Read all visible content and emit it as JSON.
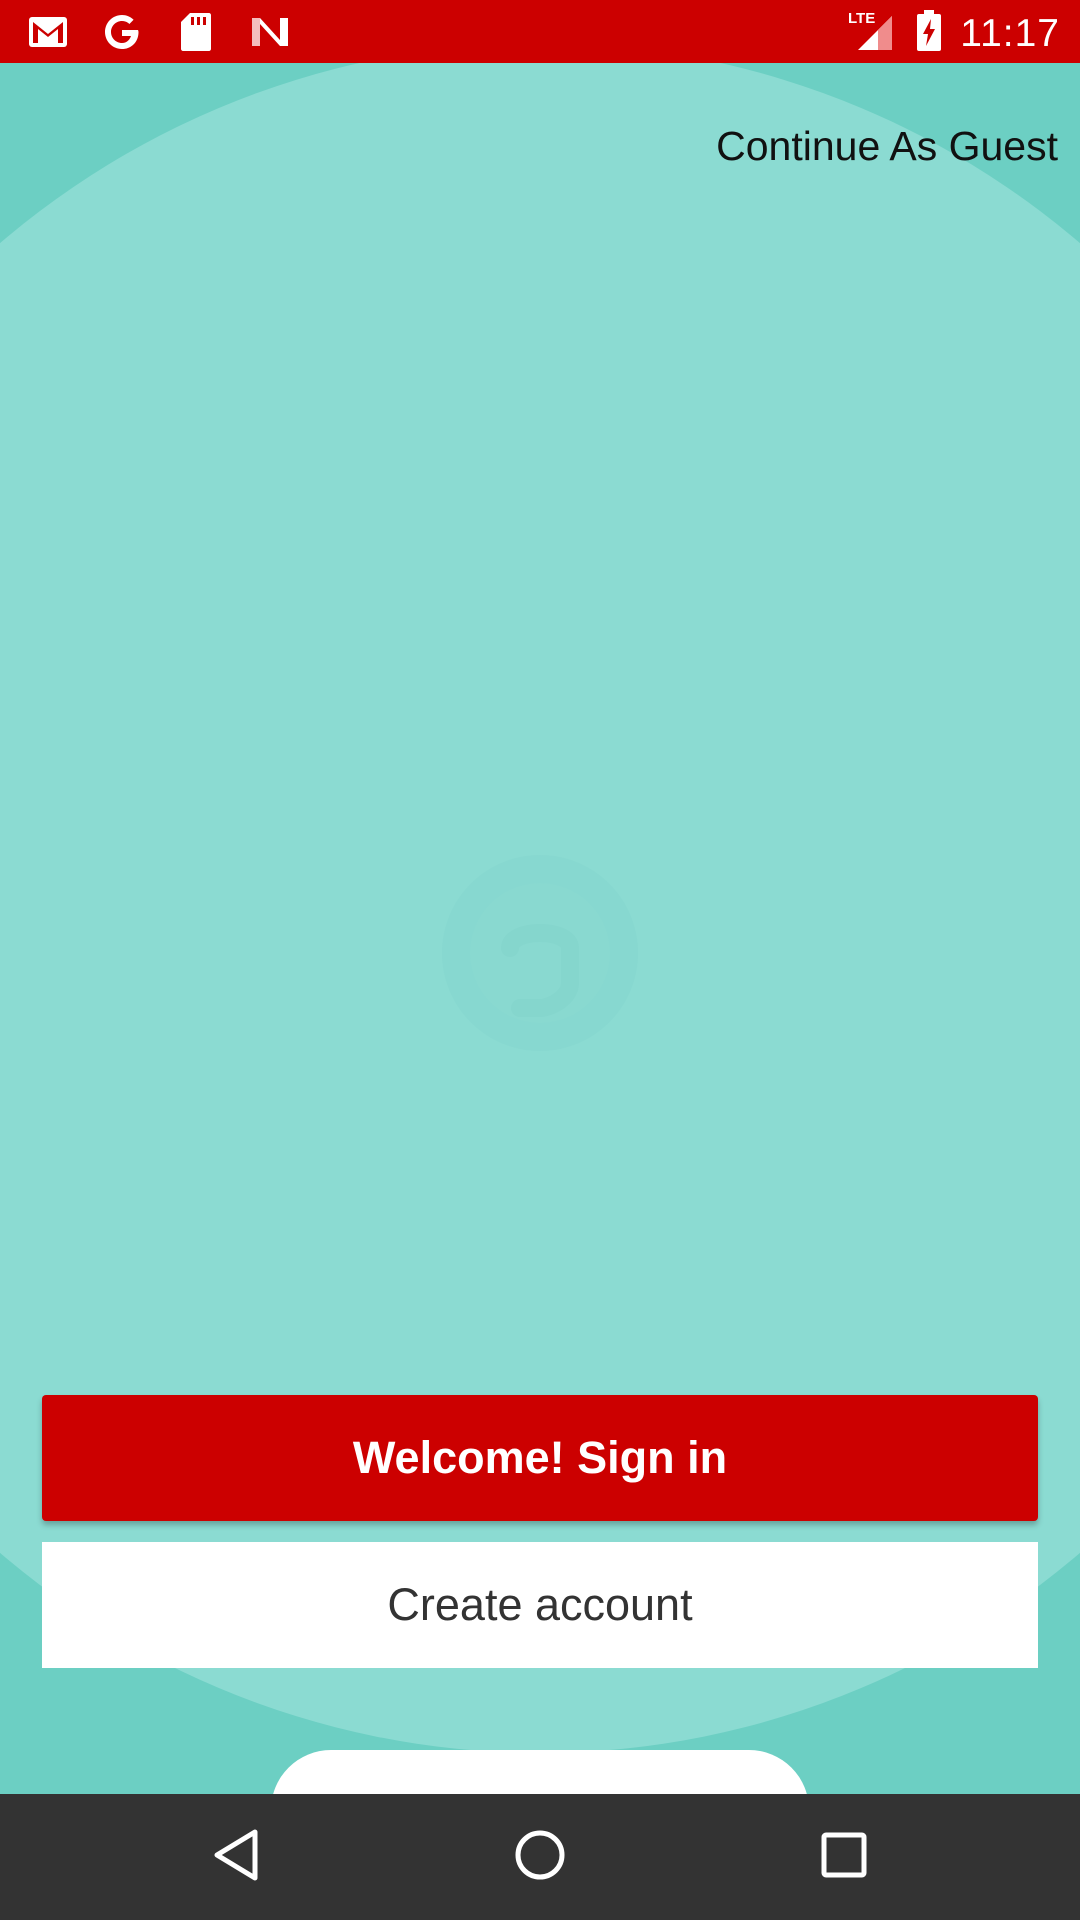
{
  "status_bar": {
    "time": "11:17",
    "network_label": "LTE",
    "left_icons": [
      "gmail-icon",
      "google-icon",
      "sd-card-icon",
      "news-icon"
    ],
    "right_icons": [
      "lte-signal-icon",
      "battery-charging-icon"
    ],
    "color": "#cc0000"
  },
  "header": {
    "guest_link": "Continue As Guest"
  },
  "actions": {
    "signin_label": "Welcome! Sign in",
    "create_account_label": "Create account"
  },
  "nav_bar": {
    "icons": [
      "back-icon",
      "home-icon",
      "recents-icon"
    ]
  },
  "colors": {
    "primary": "#cc0000",
    "background": "#8bdbd2",
    "background_dark": "#6ccfc3"
  }
}
